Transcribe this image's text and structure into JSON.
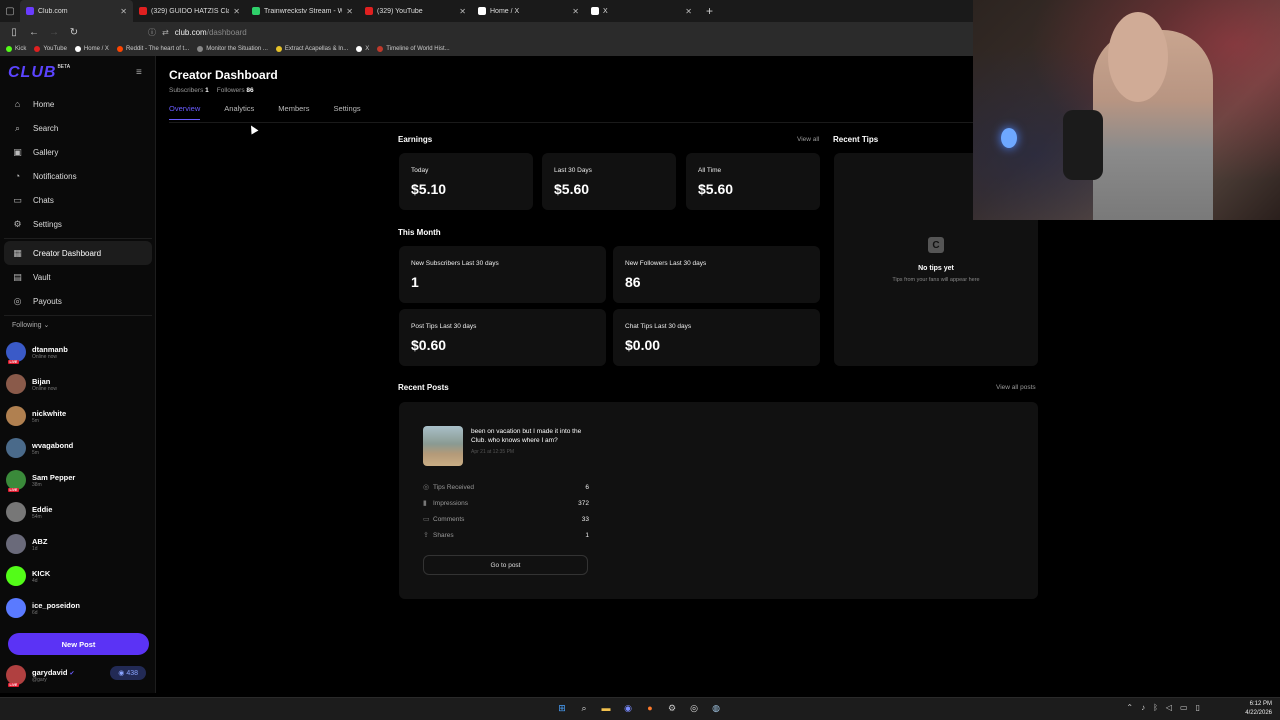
{
  "browser": {
    "tabs": [
      {
        "title": "Club.com",
        "color": "#6a3cff",
        "active": true
      },
      {
        "title": "(329) GUIDO HATZIS Classic Ca",
        "color": "#e02020",
        "active": false
      },
      {
        "title": "Trainwreckstv Stream - Watch L",
        "color": "#2fd06a",
        "active": false
      },
      {
        "title": "(329) YouTube",
        "color": "#e02020",
        "active": false
      },
      {
        "title": "Home / X",
        "color": "#ffffff",
        "active": false
      },
      {
        "title": "X",
        "color": "#ffffff",
        "active": false
      }
    ],
    "close_glyph": "✕",
    "new_tab": "+",
    "url_domain": "club.com",
    "url_path": "/dashboard",
    "bookmarks": [
      {
        "label": "Kick",
        "color": "#53fc18"
      },
      {
        "label": "YouTube",
        "color": "#e02020"
      },
      {
        "label": "Home / X",
        "color": "#ffffff"
      },
      {
        "label": "Reddit - The heart of t...",
        "color": "#ff4500"
      },
      {
        "label": "Monitor the Situation ...",
        "color": "#888888"
      },
      {
        "label": "Extract Acapellas & In...",
        "color": "#e6c229"
      },
      {
        "label": "X",
        "color": "#ffffff"
      },
      {
        "label": "Timeline of World Hist...",
        "color": "#c0392b"
      }
    ]
  },
  "sidebar": {
    "logo": "CLUB",
    "beta": "BETA",
    "nav": [
      {
        "label": "Home",
        "icon": "⌂"
      },
      {
        "label": "Search",
        "icon": "⌕"
      },
      {
        "label": "Gallery",
        "icon": "▣"
      },
      {
        "label": "Notifications",
        "icon": "◔"
      },
      {
        "label": "Chats",
        "icon": "▭"
      },
      {
        "label": "Settings",
        "icon": "⚙"
      }
    ],
    "nav2": [
      {
        "label": "Creator Dashboard",
        "icon": "▦",
        "active": true
      },
      {
        "label": "Vault",
        "icon": "▤"
      },
      {
        "label": "Payouts",
        "icon": "◎"
      }
    ],
    "following_label": "Following",
    "live_badge": "LIVE",
    "following": [
      {
        "name": "dtanmanb",
        "sub": "Online now",
        "color": "#3a5ac8",
        "live": true
      },
      {
        "name": "Bijan",
        "sub": "Online now",
        "color": "#8a5a4a",
        "live": false
      },
      {
        "name": "nickwhite",
        "sub": "5m",
        "color": "#b08050",
        "live": false
      },
      {
        "name": "wvagabond",
        "sub": "5m",
        "color": "#4a6a8a",
        "live": false
      },
      {
        "name": "Sam Pepper",
        "sub": "38m",
        "color": "#3a8a3a",
        "live": true
      },
      {
        "name": "Eddie",
        "sub": "54m",
        "color": "#777777",
        "live": false
      },
      {
        "name": "ABZ",
        "sub": "1d",
        "color": "#6a6a7a",
        "live": false
      },
      {
        "name": "KICK",
        "sub": "4d",
        "color": "#53fc18",
        "live": false
      },
      {
        "name": "ice_poseidon",
        "sub": "6d",
        "color": "#5a7aff",
        "live": false
      }
    ],
    "new_post": "New Post",
    "user": {
      "name": "garydavid",
      "handle": "@gary",
      "coins": "438"
    }
  },
  "main": {
    "title": "Creator Dashboard",
    "subscribers_label": "Subscribers",
    "subscribers": "1",
    "followers_label": "Followers",
    "followers": "86",
    "tabs": [
      "Overview",
      "Analytics",
      "Members",
      "Settings"
    ],
    "earnings_title": "Earnings",
    "view_all": "View all",
    "earnings": [
      {
        "label": "Today",
        "value": "$5.10"
      },
      {
        "label": "Last 30 Days",
        "value": "$5.60"
      },
      {
        "label": "All Time",
        "value": "$5.60"
      }
    ],
    "month_title": "This Month",
    "month": [
      {
        "label": "New Subscribers Last 30 days",
        "value": "1"
      },
      {
        "label": "New Followers Last 30 days",
        "value": "86"
      },
      {
        "label": "Post Tips Last 30 days",
        "value": "$0.60"
      },
      {
        "label": "Chat Tips Last 30 days",
        "value": "$0.00"
      }
    ],
    "tips_title": "Recent Tips",
    "no_tips": "No tips yet",
    "no_tips_sub": "Tips from your fans will appear here",
    "posts_title": "Recent Posts",
    "view_all_posts": "View all posts",
    "post": {
      "title": "been on vacation but I made it into the Club. who knows where I am?",
      "date": "Apr 21 at 12:35 PM",
      "stats": [
        {
          "label": "Tips Received",
          "value": "6",
          "icon": "◎"
        },
        {
          "label": "Impressions",
          "value": "372",
          "icon": "▮"
        },
        {
          "label": "Comments",
          "value": "33",
          "icon": "▭"
        },
        {
          "label": "Shares",
          "value": "1",
          "icon": "⇪"
        }
      ],
      "go": "Go to post"
    }
  },
  "taskbar": {
    "time": "6:12 PM",
    "date": "4/22/2026"
  }
}
